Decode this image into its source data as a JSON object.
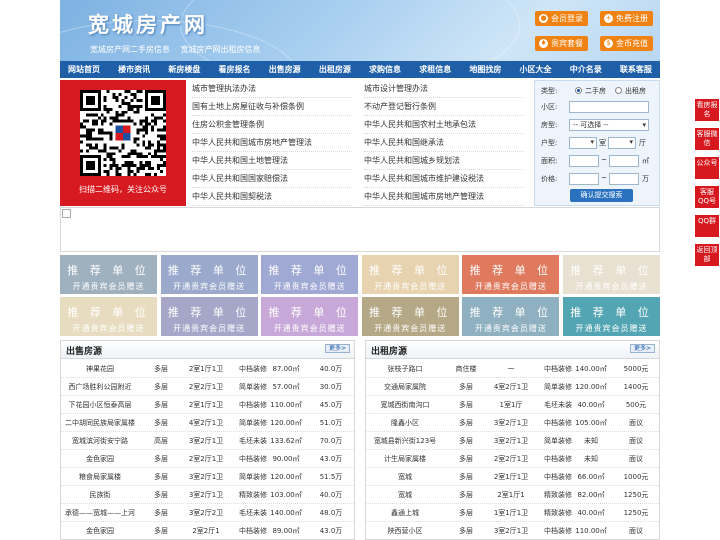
{
  "header": {
    "title": "宽城房产网",
    "subtitle_links": [
      "宽城房产网二手房信息",
      "宽城房产网出租房信息"
    ],
    "buttons": [
      {
        "label": "会员登录",
        "icon": "user-icon"
      },
      {
        "label": "免费注册",
        "icon": "register-icon"
      },
      {
        "label": "贵宾套餐",
        "icon": "vip-icon"
      },
      {
        "label": "金币充值",
        "icon": "coin-icon"
      }
    ]
  },
  "nav": [
    "网站首页",
    "楼市资讯",
    "新房楼盘",
    "看房报名",
    "出售房源",
    "出租房源",
    "求购信息",
    "求租信息",
    "地图找房",
    "小区大全",
    "中介名录",
    "联系客服"
  ],
  "qr": {
    "caption": "扫描二维码，关注公众号"
  },
  "links": {
    "left": [
      "城市管理执法办法",
      "国有土地上房屋征收与补偿条例",
      "住房公积金管理条例",
      "中华人民共和国城市房地产管理法",
      "中华人民共和国土地管理法",
      "中华人民共和国国家赔偿法",
      "中华人民共和国契税法"
    ],
    "right": [
      "城市设计管理办法",
      "不动产登记暂行条例",
      "中华人民共和国农村土地承包法",
      "中华人民共和国继承法",
      "中华人民共和国城乡规划法",
      "中华人民共和国城市维护建设税法",
      "中华人民共和国城市房地产管理法"
    ]
  },
  "search": {
    "type_label": "类型:",
    "type_options": [
      "二手房",
      "出租房"
    ],
    "community_label": "小区:",
    "property_label": "房型:",
    "property_value": "-- 可选择 --",
    "layout_label": "户型:",
    "room_unit": "室",
    "hall_unit": "厅",
    "area_label": "面积:",
    "area_unit": "㎡",
    "price_label": "价格:",
    "price_unit": "万",
    "range_sep": "~",
    "submit": "确认提交搜索"
  },
  "ads": {
    "title": "推 荐 单 位",
    "subtitle": "开通贵宾会员赠送",
    "colors": [
      "#9fb0bf",
      "#9aa9cc",
      "#a0a8d4",
      "#e7d3b0",
      "#e07a5f",
      "#e8e0d0",
      "#e8dcc0",
      "#a6a7c8",
      "#c8a8d8",
      "#b4a886",
      "#8fb0c0",
      "#54a5b3"
    ]
  },
  "sale": {
    "title": "出售房源",
    "more": "更多>",
    "rows": [
      [
        "神果花园",
        "多层",
        "2室1厅1卫",
        "中档装修",
        "87.00㎡",
        "40.0万"
      ],
      [
        "西广场胜利公园附近",
        "多层",
        "2室2厅1卫",
        "简单装修",
        "57.00㎡",
        "30.0万"
      ],
      [
        "下花园小区恒泰高层",
        "多层",
        "2室1厅1卫",
        "中档装修",
        "110.00㎡",
        "45.0万"
      ],
      [
        "二中胡同民族局家属楼",
        "多层",
        "4室2厅1卫",
        "简单装修",
        "120.00㎡",
        "51.0万"
      ],
      [
        "宽城滨河街安宁路",
        "高层",
        "3室2厅1卫",
        "毛坯未装",
        "133.62㎡",
        "70.0万"
      ],
      [
        "金色家园",
        "多层",
        "2室2厅1卫",
        "中档装修",
        "90.00㎡",
        "43.0万"
      ],
      [
        "粮食局家属楼",
        "多层",
        "3室2厅1卫",
        "简单装修",
        "120.00㎡",
        "51.5万"
      ],
      [
        "民族街",
        "多层",
        "3室2厅1卫",
        "精致装修",
        "103.00㎡",
        "40.0万"
      ],
      [
        "承德——宽城——上河",
        "多层",
        "3室2厅2卫",
        "毛坯未装",
        "140.00㎡",
        "48.0万"
      ],
      [
        "金色家园",
        "多层",
        "2室2厅1",
        "中档装修",
        "89.00㎡",
        "43.0万"
      ]
    ]
  },
  "rent": {
    "title": "出租房源",
    "more": "更多>",
    "rows": [
      [
        "张枝子路口",
        "商住楼",
        "一",
        "中档装修",
        "140.00㎡",
        "5000元"
      ],
      [
        "交通局家属院",
        "多层",
        "4室2厅1卫",
        "简单装修",
        "120.00㎡",
        "1400元"
      ],
      [
        "宽城西街南沟口",
        "多层",
        "1室1厅",
        "毛坯未装",
        "40.00㎡",
        "500元"
      ],
      [
        "隆鑫小区",
        "多层",
        "3室2厅1卫",
        "中档装修",
        "105.00㎡",
        "面议"
      ],
      [
        "宽城县新兴街123号",
        "多层",
        "3室2厅1卫",
        "简单装修",
        "未知",
        "面议"
      ],
      [
        "计生局家属楼",
        "多层",
        "2室2厅1卫",
        "中档装修",
        "未知",
        "面议"
      ],
      [
        "宽城",
        "多层",
        "2室1厅1卫",
        "中档装修",
        "66.00㎡",
        "1000元"
      ],
      [
        "宽城",
        "多层",
        "2室1厅1",
        "精致装修",
        "82.00㎡",
        "1250元"
      ],
      [
        "鑫通上城",
        "多层",
        "1室1厅1卫",
        "精致装修",
        "40.00㎡",
        "1250元"
      ],
      [
        "陕西营小区",
        "多层",
        "3室2厅1卫",
        "中档装修",
        "110.00㎡",
        "面议"
      ]
    ]
  },
  "side_tools": [
    "看房报名",
    "客服微信",
    "公众号",
    "客服QQ号",
    "QQ群",
    "返回顶部"
  ]
}
